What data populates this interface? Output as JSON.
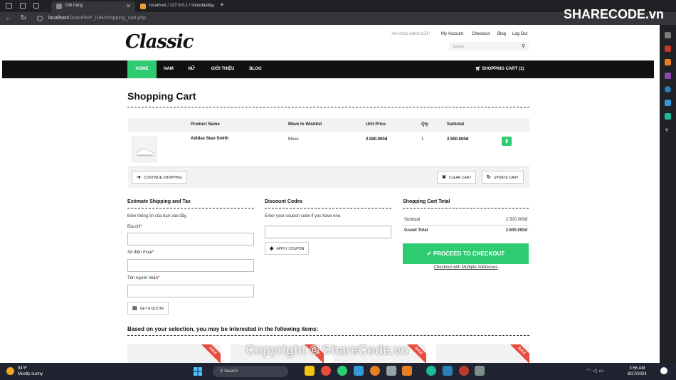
{
  "browser": {
    "tabs": [
      {
        "label": "Giỏ hàng"
      },
      {
        "label": "localhost / 127.0.0.1 / shoedatab"
      }
    ],
    "url_host": "localhost",
    "url_path": "/DoAnPHP_IUH/shopping_cart.php"
  },
  "watermark": {
    "top_logo": "SHARECODE.vn",
    "center": "Copyright © ShareCode.vn"
  },
  "site": {
    "logo": "Classic",
    "welcome": "Xin chào admin123 !",
    "links": [
      "My Account",
      "Checkout",
      "Blog",
      "Log Out"
    ],
    "search_placeholder": "Search",
    "nav": [
      "HOME",
      "NAM",
      "NỮ",
      "GIỚI THIỆU",
      "BLOG"
    ],
    "cart_label": "SHOPPING CART (1)"
  },
  "cart": {
    "title": "Shopping Cart",
    "headers": [
      "Product Name",
      "Move to Wishlist",
      "Unit Price",
      "Qty",
      "Subtotal"
    ],
    "items": [
      {
        "name": "Adidas Stan Smith",
        "move": "Move",
        "price": "2.500.000đ",
        "qty": "1",
        "subtotal": "2.500.000đ"
      }
    ],
    "continue": "CONTINUE SHOPPING",
    "clear": "CLEAR CART",
    "update": "UPDATE CART"
  },
  "shipping": {
    "title": "Estimate Shipping and Tax",
    "intro": "Điền thông tin của bạn vào đây.",
    "address": "Địa chỉ",
    "phone": "Số điện thoại",
    "receiver": "Tên người nhận",
    "quote": "GET A QUOTE"
  },
  "discount": {
    "title": "Discount Codes",
    "intro": "Enter your coupon code if you have one.",
    "apply": "APPLY COUPON"
  },
  "totals": {
    "title": "Shopping Cart Total",
    "subtotal_label": "Subtotal",
    "subtotal": "2.500.000đ",
    "grand_label": "Grand Total",
    "grand": "2.500.000đ",
    "checkout": "PROCEED TO CHECKOUT",
    "multi": "Checkout with Multiple Addresses"
  },
  "suggest": {
    "title": "Based on your selection, you may be interested in the following items:",
    "sale": "SALE"
  },
  "taskbar": {
    "temp": "94°F",
    "weather": "Mostly sunny",
    "search": "Search",
    "time": "3:56 AM",
    "date": "8/27/2024"
  }
}
